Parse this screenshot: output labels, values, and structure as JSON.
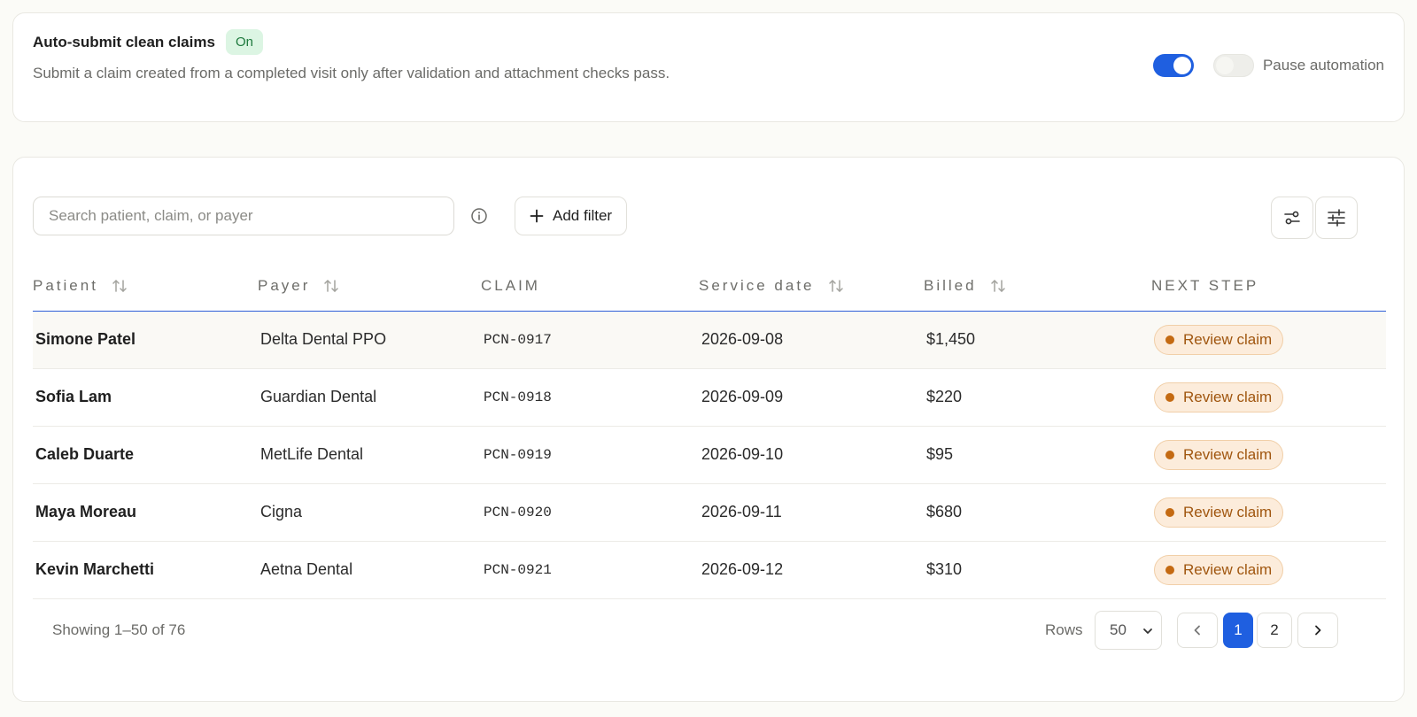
{
  "automation": {
    "title": "Auto-submit clean claims",
    "status_badge": "On",
    "description": "Submit a claim created from a completed visit only after validation and attachment checks pass.",
    "auto_submit_enabled": true,
    "pause_enabled": false,
    "pause_label": "Pause automation"
  },
  "toolbar": {
    "search_placeholder": "Search patient, claim, or payer",
    "add_filter_label": "Add filter"
  },
  "table": {
    "columns": [
      {
        "label": "Patient",
        "sortable": true
      },
      {
        "label": "Payer",
        "sortable": true
      },
      {
        "label": "CLAIM",
        "sortable": false
      },
      {
        "label": "Service date",
        "sortable": true
      },
      {
        "label": "Billed",
        "sortable": true
      },
      {
        "label": "NEXT STEP",
        "sortable": false
      }
    ],
    "rows": [
      {
        "patient": "Simone Patel",
        "payer": "Delta Dental PPO",
        "claim": "PCN-0917",
        "service_date": "2026-09-08",
        "billed": "$1,450",
        "next_step": "Review claim"
      },
      {
        "patient": "Sofia Lam",
        "payer": "Guardian Dental",
        "claim": "PCN-0918",
        "service_date": "2026-09-09",
        "billed": "$220",
        "next_step": "Review claim"
      },
      {
        "patient": "Caleb Duarte",
        "payer": "MetLife Dental",
        "claim": "PCN-0919",
        "service_date": "2026-09-10",
        "billed": "$95",
        "next_step": "Review claim"
      },
      {
        "patient": "Maya Moreau",
        "payer": "Cigna",
        "claim": "PCN-0920",
        "service_date": "2026-09-11",
        "billed": "$680",
        "next_step": "Review claim"
      },
      {
        "patient": "Kevin Marchetti",
        "payer": "Aetna Dental",
        "claim": "PCN-0921",
        "service_date": "2026-09-12",
        "billed": "$310",
        "next_step": "Review claim"
      }
    ]
  },
  "footer": {
    "showing_text": "Showing 1–50 of 76",
    "rows_label": "Rows",
    "rows_value": "50",
    "pages": [
      "1",
      "2"
    ],
    "current_page": "1"
  },
  "colors": {
    "accent": "#1f5fe0",
    "status_on_bg": "#dcf5e3",
    "pill_bg": "#fcecdb",
    "pill_text": "#a0560f"
  }
}
